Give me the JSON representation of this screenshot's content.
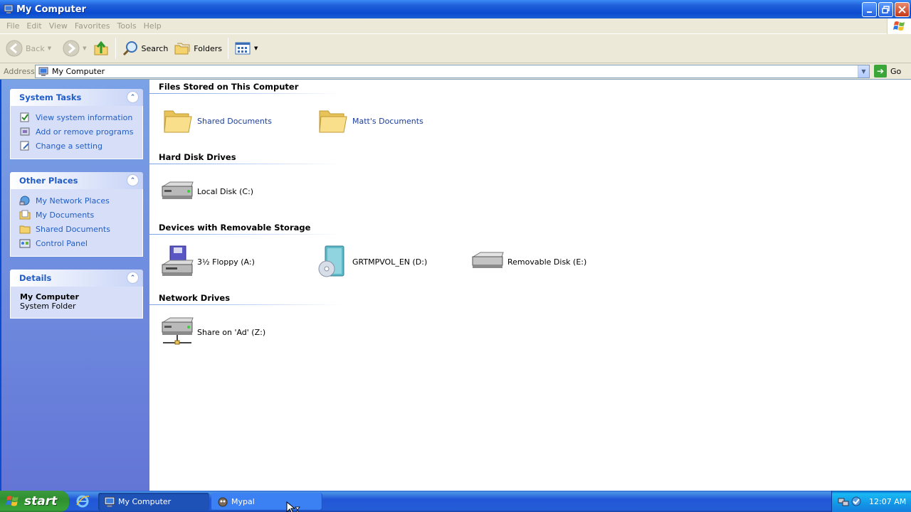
{
  "window": {
    "title": "My Computer"
  },
  "menu": [
    "File",
    "Edit",
    "View",
    "Favorites",
    "Tools",
    "Help"
  ],
  "toolbar": {
    "back_label": "Back",
    "search_label": "Search",
    "folders_label": "Folders"
  },
  "address": {
    "label": "Address",
    "value": "My Computer",
    "go_label": "Go"
  },
  "sidebar": {
    "system_tasks": {
      "title": "System Tasks",
      "items": [
        {
          "label": "View system information",
          "icon": "system-info-icon"
        },
        {
          "label": "Add or remove programs",
          "icon": "add-remove-programs-icon"
        },
        {
          "label": "Change a setting",
          "icon": "change-setting-icon"
        }
      ]
    },
    "other_places": {
      "title": "Other Places",
      "items": [
        {
          "label": "My Network Places",
          "icon": "network-places-icon"
        },
        {
          "label": "My Documents",
          "icon": "my-documents-icon"
        },
        {
          "label": "Shared Documents",
          "icon": "shared-documents-icon"
        },
        {
          "label": "Control Panel",
          "icon": "control-panel-icon"
        }
      ]
    },
    "details": {
      "title": "Details",
      "name": "My Computer",
      "type": "System Folder"
    }
  },
  "groups": [
    {
      "title": "Files Stored on This Computer",
      "items": [
        {
          "label": "Shared Documents",
          "icon": "folder-icon"
        },
        {
          "label": "Matt's Documents",
          "icon": "folder-icon"
        }
      ]
    },
    {
      "title": "Hard Disk Drives",
      "items": [
        {
          "label": "Local Disk (C:)",
          "icon": "hard-disk-icon"
        }
      ]
    },
    {
      "title": "Devices with Removable Storage",
      "items": [
        {
          "label": "3½ Floppy (A:)",
          "icon": "floppy-icon"
        },
        {
          "label": "GRTMPVOL_EN (D:)",
          "icon": "dvd-drive-icon"
        },
        {
          "label": "Removable Disk (E:)",
          "icon": "removable-disk-icon"
        }
      ]
    },
    {
      "title": "Network Drives",
      "items": [
        {
          "label": "Share on 'Ad' (Z:)",
          "icon": "network-drive-icon"
        }
      ]
    }
  ],
  "taskbar": {
    "start_label": "start",
    "tasks": [
      {
        "label": "My Computer",
        "active": true
      },
      {
        "label": "Mypal",
        "active": false
      }
    ],
    "clock": "12:07 AM"
  },
  "colors": {
    "titlebar": "#0a4bd0",
    "taskpane": "#6375d6",
    "link": "#215dc6",
    "start_green": "#2f8f2f"
  }
}
